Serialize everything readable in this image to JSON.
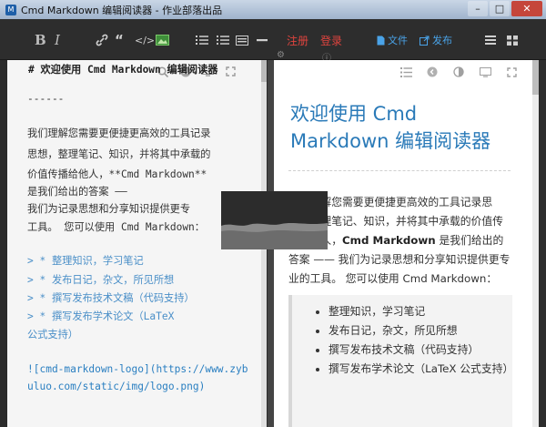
{
  "window": {
    "title": "Cmd Markdown 编辑阅读器 - 作业部落出品"
  },
  "toolbar": {
    "bold_label": "B",
    "italic_label": "I",
    "register_label": "注册",
    "login_label": "登录",
    "file_label": "文件",
    "publish_label": "发布"
  },
  "editor": {
    "lines": [
      "# 欢迎使用 Cmd Markdown 编辑阅读器",
      "------",
      "我们理解您需要更便捷更高效的工具记录",
      "思想，整理笔记、知识，并将其中承载的",
      "价值传播给他人，**Cmd Markdown**",
      "是我们给出的答案 ——",
      "我们为记录思想和分享知识提供更专",
      "工具。 您可以使用 Cmd Markdown：",
      "> * 整理知识，学习笔记",
      "> * 发布日记，杂文，所见所想",
      "> * 撰写发布技术文稿（代码支持）",
      "> * 撰写发布学术论文（LaTeX",
      "公式支持）",
      "![cmd-markdown-logo](https://www.zyb",
      "uluo.com/static/img/logo.png)"
    ]
  },
  "preview": {
    "title": "欢迎使用 Cmd Markdown 编辑阅读器",
    "para_1": "我们理解您需要更便捷更高效的工具记录思想，整理笔记、知识，并将其中承载的价值传播给他人，",
    "para_bold": "Cmd Markdown",
    "para_2": "是我们给出的答案 —— 我们为记录思想和分享知识提供更专业的工具。 您可以使用 Cmd Markdown：",
    "list": [
      "整理知识，学习笔记",
      "发布日记，杂文，所见所想",
      "撰写发布技术文稿（代码支持）",
      "撰写发布学术论文（LaTeX 公式支持）"
    ]
  },
  "colors": {
    "toolbar_bg": "#2d2d2d",
    "accent_red": "#e0443e",
    "accent_blue": "#4aa3e8",
    "heading_blue": "#2a7ab8"
  }
}
